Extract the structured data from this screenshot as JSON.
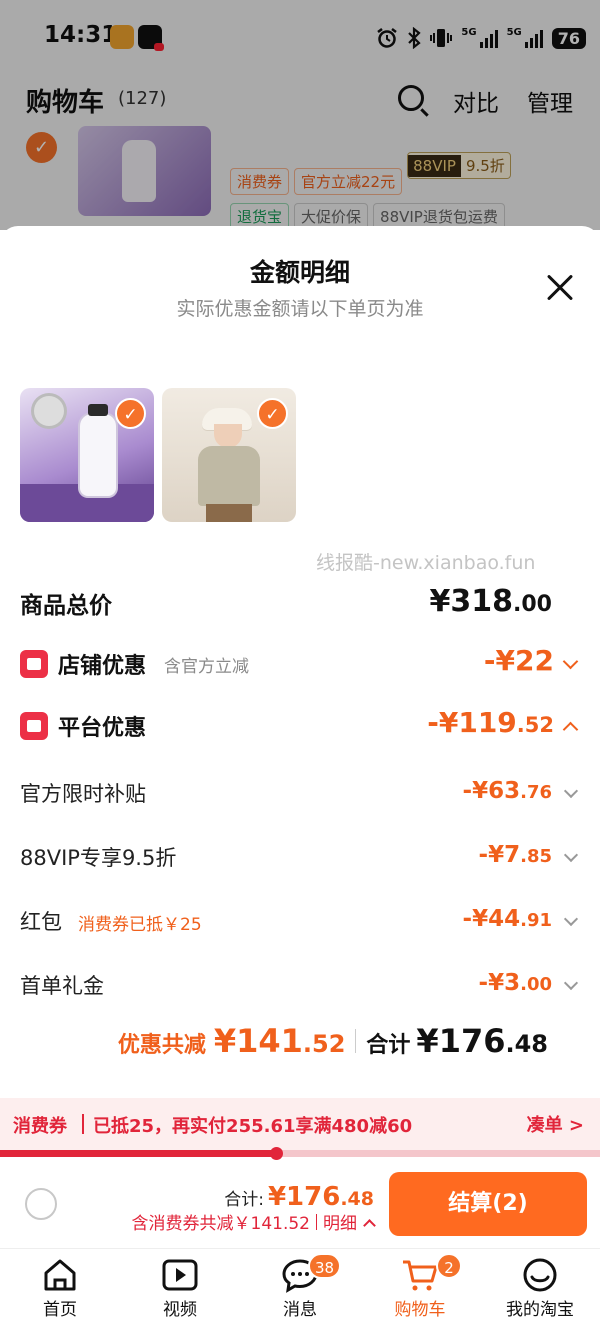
{
  "status_bar": {
    "time": "14:31",
    "network_1": "5G",
    "network_2": "5G",
    "battery": "76"
  },
  "cart_header": {
    "title": "购物车",
    "count": "(127)",
    "compare_label": "对比",
    "manage_label": "管理"
  },
  "cart_item": {
    "tags_row1": [
      "消费券",
      "官方立减22元"
    ],
    "vip_badge": "88VIP",
    "vip_discount": "9.5折",
    "tags_row2": [
      "退货宝",
      "大促价保",
      "88VIP退货包运费"
    ]
  },
  "sheet": {
    "title": "金额明细",
    "subtitle": "实际优惠金额请以下单页为准",
    "watermark": "线报酷-new.xianbao.fun",
    "total_label": "商品总价",
    "total_value": "¥318",
    "total_value_dec": ".00",
    "store_discount": {
      "label": "店铺优惠",
      "note": "含官方立减",
      "value": "-¥22",
      "value_dec": ""
    },
    "platform_discount": {
      "label": "平台优惠",
      "value": "-¥119",
      "value_dec": ".52"
    },
    "sub_items": [
      {
        "label": "官方限时补贴",
        "note": "",
        "value": "-¥63",
        "value_dec": ".76"
      },
      {
        "label": "88VIP专享9.5折",
        "note": "",
        "value": "-¥7",
        "value_dec": ".85"
      },
      {
        "label": "红包",
        "note": "消费券已抵￥25",
        "value": "-¥44",
        "value_dec": ".91"
      },
      {
        "label": "首单礼金",
        "note": "",
        "value": "-¥3",
        "value_dec": ".00"
      }
    ],
    "summary": {
      "discount_label": "优惠共减",
      "discount_value": "¥141",
      "discount_value_dec": ".52",
      "total_label": "合计",
      "total_value": "¥176",
      "total_value_dec": ".48"
    }
  },
  "coupon_bar": {
    "tag": "消费券",
    "text": "已抵25，再实付255.61享满480减60",
    "link": "凑单 >",
    "progress": 0.46
  },
  "checkout": {
    "total_label": "合计:",
    "total_value": "¥176",
    "total_value_dec": ".48",
    "discount_text": "含消费券共减￥141.52",
    "detail_label": "明细",
    "button_label": "结算(2)"
  },
  "tabbar": {
    "items": [
      {
        "label": "首页",
        "icon": "home-icon",
        "badge": ""
      },
      {
        "label": "视频",
        "icon": "video-icon",
        "badge": ""
      },
      {
        "label": "消息",
        "icon": "message-icon",
        "badge": "38"
      },
      {
        "label": "购物车",
        "icon": "cart-icon",
        "badge": "2"
      },
      {
        "label": "我的淘宝",
        "icon": "profile-icon",
        "badge": ""
      }
    ],
    "active_index": 3
  },
  "colors": {
    "accent": "#f0601c",
    "button": "#ff6a20",
    "coupon_red": "#e1253a"
  }
}
